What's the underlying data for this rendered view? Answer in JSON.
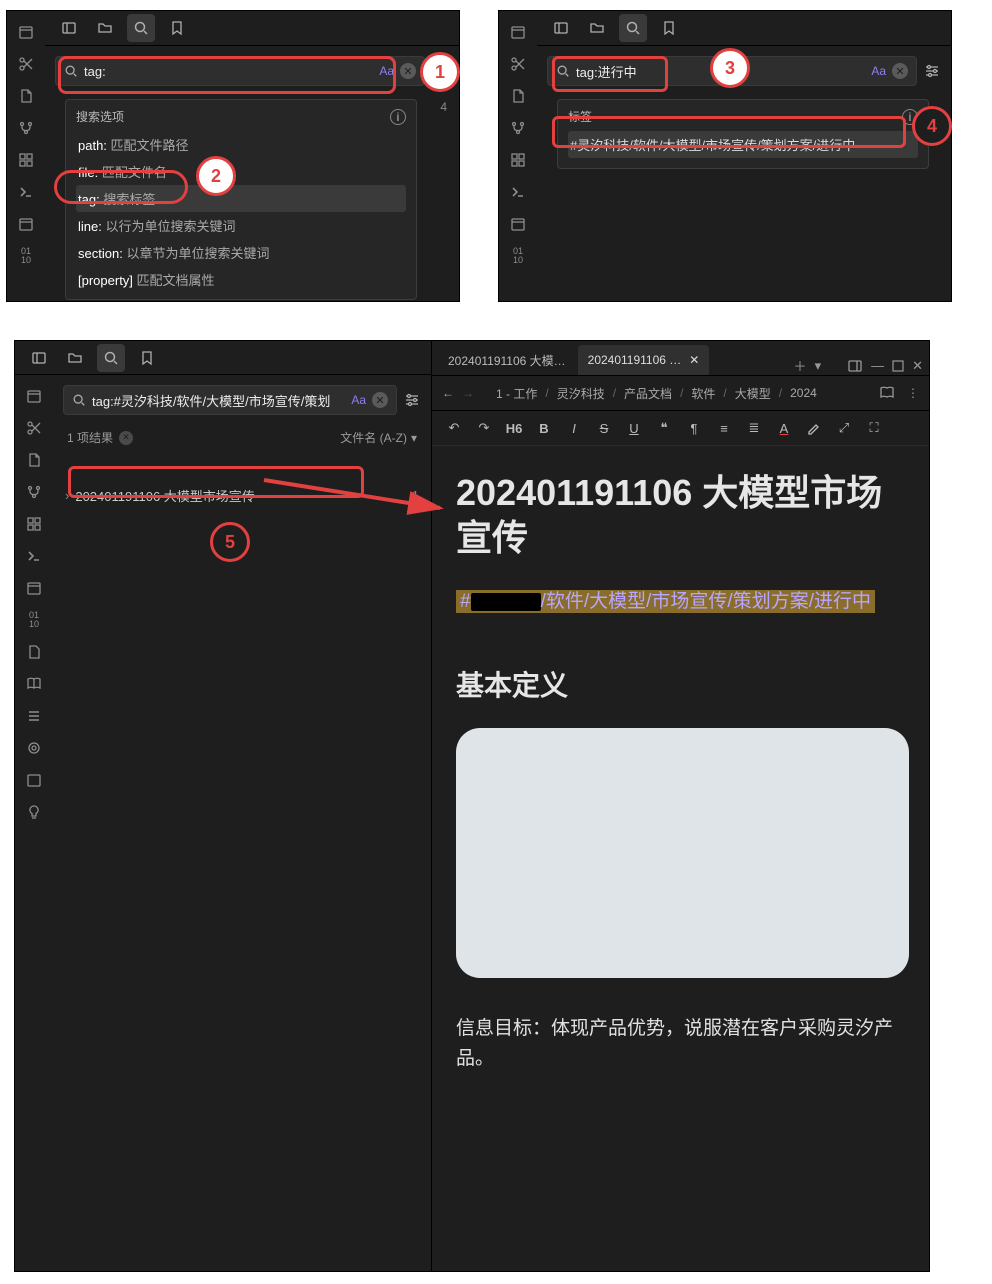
{
  "panel1": {
    "search_value": "tag:",
    "aa_label": "Aa",
    "filters_label": "4",
    "dropdown_title": "搜索选项",
    "options": [
      {
        "key": "path:",
        "desc": "匹配文件路径"
      },
      {
        "key": "file:",
        "desc": "匹配文件名"
      },
      {
        "key": "tag:",
        "desc": "搜索标签"
      },
      {
        "key": "line:",
        "desc": "以行为单位搜索关键词"
      },
      {
        "key": "section:",
        "desc": "以章节为单位搜索关键词"
      },
      {
        "key": "[property]",
        "desc": "匹配文档属性"
      }
    ]
  },
  "panel2": {
    "search_value": "tag:进行中",
    "aa_label": "Aa",
    "dropdown_title": "标签",
    "suggestion": "#灵汐科技/软件/大模型/市场宣传/策划方案/进行中"
  },
  "panel3": {
    "search_value": "tag:#灵汐科技/软件/大模型/市场宣传/策划",
    "aa_label": "Aa",
    "result_count": "1 项结果",
    "sort_label": "文件名 (A-Z)",
    "result_title": "202401191106 大模型市场宣传",
    "result_matchcount": "1",
    "tabs": {
      "inactive": "202401191106 大模…",
      "active": "202401191106 …"
    },
    "crumbs": [
      "1 - 工作",
      "灵汐科技",
      "产品文档",
      "软件",
      "大模型",
      "2024"
    ],
    "fmt": {
      "h6": "H6",
      "b": "B",
      "i": "I",
      "s": "S",
      "u": "U",
      "a": "A"
    },
    "doc": {
      "title": "202401191106 大模型市场宣传",
      "tag_prefix": "#",
      "tag_rest": "/软件/大模型/市场宣传/策划方案/进行中",
      "h2": "基本定义",
      "para": "信息目标：体现产品优势，说服潜在客户采购灵汐产品。"
    }
  },
  "annotations": {
    "n1": "1",
    "n2": "2",
    "n3": "3",
    "n4": "4",
    "n5": "5"
  }
}
